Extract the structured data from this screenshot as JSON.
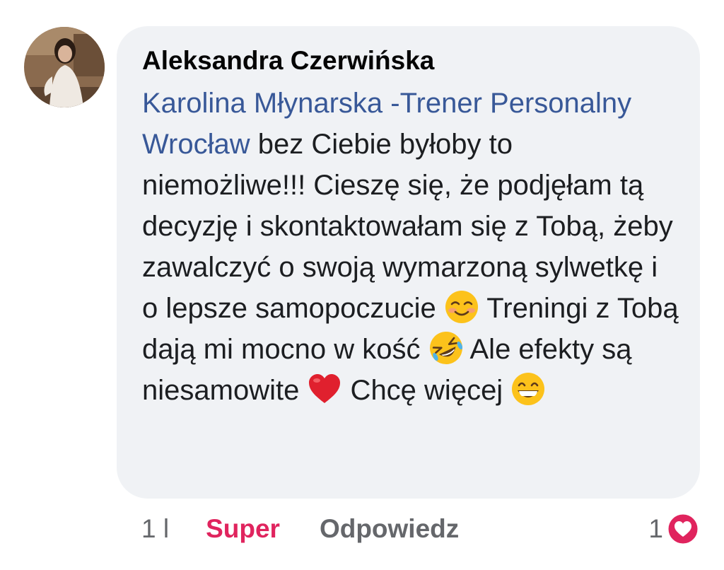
{
  "comment": {
    "author": "Aleksandra Czerwińska",
    "mention": "Karolina Młynarska -Trener Personalny Wrocław",
    "text_part1": " bez Ciebie byłoby to niemożliwe!!! Cieszę się, że podjęłam tą decyzję i skontaktowałam się z Tobą, żeby zawalczyć o swoją wymarzoną sylwetkę i o lepsze samopoczucie ",
    "emoji1": "smiling-blushing-emoji",
    "text_part2": " Treningi z Tobą dają mi mocno w kość ",
    "emoji2": "rolling-laughing-emoji",
    "text_part3": " Ale efekty są niesamowite ",
    "emoji3": "red-heart-emoji",
    "text_part4": " Chcę więcej ",
    "emoji4": "grinning-emoji"
  },
  "actions": {
    "time": "1 l",
    "like_label": "Super",
    "reply_label": "Odpowiedz"
  },
  "reactions": {
    "count": "1",
    "icon": "heart-reaction-icon",
    "color": "#e0245e"
  },
  "colors": {
    "bubble": "#f0f2f5",
    "mention": "#385898",
    "like_active": "#e0245e",
    "meta": "#65676b"
  }
}
